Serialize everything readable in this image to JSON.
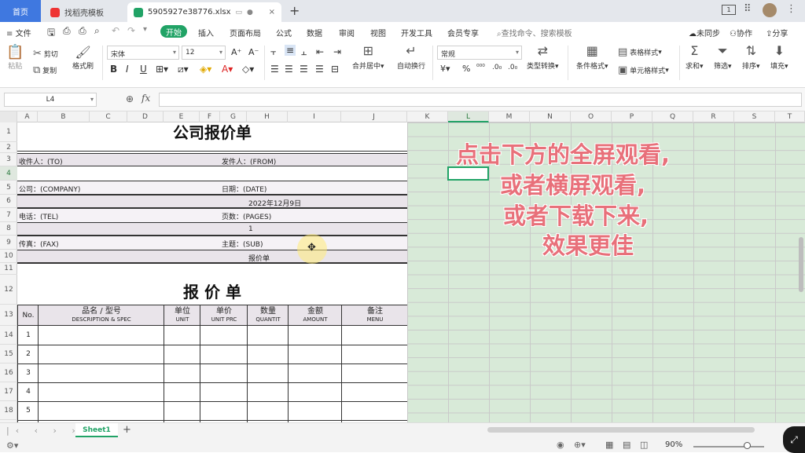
{
  "tabs": [
    {
      "label": "首页"
    },
    {
      "label": "找稻壳模板"
    },
    {
      "label": "5905927e38776.xlsx"
    }
  ],
  "tab_controls": {
    "add": "+",
    "close": "×",
    "win_box": "1"
  },
  "menu": {
    "file": "文件",
    "items": [
      "开始",
      "插入",
      "页面布局",
      "公式",
      "数据",
      "审阅",
      "视图",
      "开发工具",
      "会员专享"
    ],
    "search": "查找命令、搜索模板",
    "right": [
      "未同步",
      "协作",
      "分享"
    ]
  },
  "toolbar": {
    "paste": "粘贴",
    "cut": "剪切",
    "copy": "复制",
    "format_painter": "格式刷",
    "font_name": "宋体",
    "font_size": "12",
    "merge_center": "合并居中",
    "auto_wrap": "自动换行",
    "number_format": "常规",
    "percent": "%",
    "type_convert": "类型转换",
    "cond_format": "条件格式",
    "table_style": "表格样式",
    "cell_style": "单元格样式",
    "sum": "求和",
    "filter": "筛选",
    "sort": "排序",
    "fill": "填充"
  },
  "formula_bar": {
    "cell_ref": "L4",
    "fx": "fx",
    "formula": ""
  },
  "columns": [
    "A",
    "B",
    "C",
    "D",
    "E",
    "F",
    "G",
    "H",
    "I",
    "J",
    "K",
    "L",
    "M",
    "N",
    "O",
    "P",
    "Q",
    "R",
    "S",
    "T"
  ],
  "rows": [
    "1",
    "2",
    "3",
    "4",
    "5",
    "6",
    "7",
    "8",
    "9",
    "10",
    "11",
    "12",
    "13",
    "14",
    "15",
    "16",
    "17",
    "18"
  ],
  "doc": {
    "title": "公司报价单",
    "to": "收件人：(TO)",
    "from": "发件人：(FROM)",
    "company": "公司：(COMPANY)",
    "date_label": "日期：(DATE)",
    "date_value": "2022年12月9日",
    "tel": "电话：(TEL)",
    "pages_label": "页数：(PAGES)",
    "pages_value": "1",
    "fax": "传真：(FAX)",
    "subject_label": "主题：(SUB)",
    "subject_value": "报价单",
    "subtitle": "报 价 单",
    "table_headers": [
      {
        "cn": "No.",
        "en": ""
      },
      {
        "cn": "品名 / 型号",
        "en": "DESCRIPTION & SPEC"
      },
      {
        "cn": "单位",
        "en": "UNIT"
      },
      {
        "cn": "单价",
        "en": "UNIT PRC"
      },
      {
        "cn": "数量",
        "en": "QUANTIT"
      },
      {
        "cn": "金额",
        "en": "AMOUNT"
      },
      {
        "cn": "备注",
        "en": "MENU"
      }
    ],
    "item_numbers": [
      "1",
      "2",
      "3",
      "4",
      "5"
    ]
  },
  "overlay_lines": [
    "点击下方的全屏观看,",
    "或者横屏观看,",
    "或者下载下来,",
    "效果更佳"
  ],
  "status": {
    "sheet_tab": "Sheet1",
    "add_sheet": "+",
    "zoom": "90%"
  },
  "colors": {
    "accent": "#21a366",
    "home_tab": "#3f78e0",
    "band": "#e9e4ea",
    "grid_green": "#d8ead8",
    "overlay": "#e8707a"
  }
}
